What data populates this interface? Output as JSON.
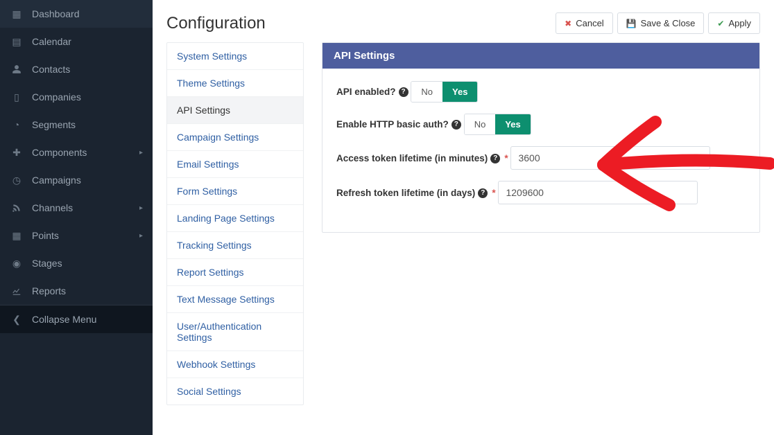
{
  "page": {
    "title": "Configuration"
  },
  "actions": {
    "cancel": "Cancel",
    "save_close": "Save & Close",
    "apply": "Apply"
  },
  "sidebar": {
    "items": [
      {
        "label": "Dashboard",
        "icon": "⊞",
        "chev": false
      },
      {
        "label": "Calendar",
        "icon": "📅",
        "chev": false
      },
      {
        "label": "Contacts",
        "icon": "👤",
        "chev": false
      },
      {
        "label": "Companies",
        "icon": "🏢",
        "chev": false
      },
      {
        "label": "Segments",
        "icon": "◔",
        "chev": false
      },
      {
        "label": "Components",
        "icon": "🧩",
        "chev": true
      },
      {
        "label": "Campaigns",
        "icon": "⏱",
        "chev": false
      },
      {
        "label": "Channels",
        "icon": "📶",
        "chev": true
      },
      {
        "label": "Points",
        "icon": "📊",
        "chev": true
      },
      {
        "label": "Stages",
        "icon": "🧭",
        "chev": false
      },
      {
        "label": "Reports",
        "icon": "📈",
        "chev": false
      }
    ],
    "collapse": "Collapse Menu"
  },
  "settings_nav": {
    "items": [
      "System Settings",
      "Theme Settings",
      "API Settings",
      "Campaign Settings",
      "Email Settings",
      "Form Settings",
      "Landing Page Settings",
      "Tracking Settings",
      "Report Settings",
      "Text Message Settings",
      "User/Authentication Settings",
      "Webhook Settings",
      "Social Settings"
    ],
    "active_index": 2
  },
  "panel": {
    "title": "API Settings",
    "toggle_options": {
      "no": "No",
      "yes": "Yes"
    },
    "api_enabled": {
      "label": "API enabled?",
      "value": "Yes"
    },
    "basic_auth": {
      "label": "Enable HTTP basic auth?",
      "value": "Yes"
    },
    "access_token": {
      "label": "Access token lifetime (in minutes)",
      "value": "3600",
      "required": "*"
    },
    "refresh_token": {
      "label": "Refresh token lifetime (in days)",
      "value": "1209600",
      "required": "*"
    }
  }
}
